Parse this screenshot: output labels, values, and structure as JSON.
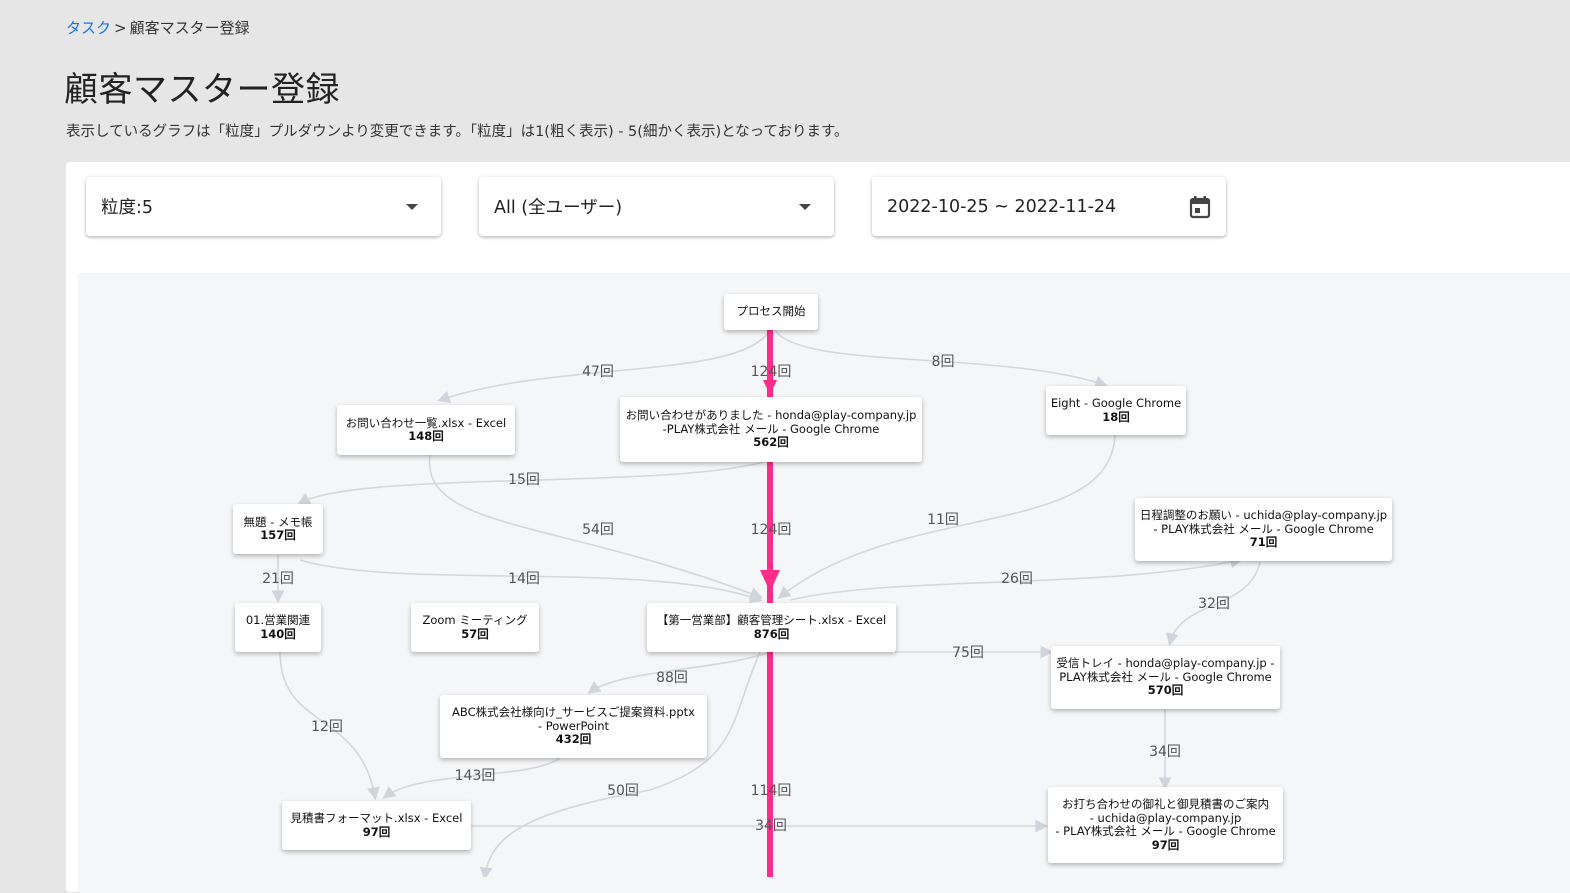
{
  "breadcrumb": {
    "link": "タスク",
    "separator": ">",
    "current": "顧客マスター登録"
  },
  "page_title": "顧客マスター登録",
  "description": "表示しているグラフは「粒度」プルダウンより変更できます。「粒度」は1(粗く表示) - 5(細かく表示)となっております。",
  "filters": {
    "granularity": "粒度:5",
    "user": "All (全ユーザー)",
    "date_range": "2022-10-25 ~ 2022-11-24"
  },
  "icons": {
    "dropdown": "caret-down-icon",
    "calendar": "calendar-icon"
  },
  "colors": {
    "main_path": "#ff2d8a",
    "edge": "#d3d8dc",
    "background": "#e6e6e6"
  },
  "nodes": {
    "start": {
      "l1": "プロセス開始"
    },
    "inquiry_list": {
      "l1": "お問い合わせ一覧.xlsx - Excel",
      "count": "148回"
    },
    "inquiry_mail": {
      "l1": "お問い合わせがありました - honda@play-company.jp",
      "l2": "-PLAY株式会社 メール - Google Chrome",
      "count": "562回"
    },
    "eight": {
      "l1": "Eight - Google Chrome",
      "count": "18回"
    },
    "memo": {
      "l1": "無題 - メモ帳",
      "count": "157回"
    },
    "schedule": {
      "l1": "日程調整のお願い - uchida@play-company.jp",
      "l2": "- PLAY株式会社 メール - Google Chrome",
      "count": "71回"
    },
    "sales": {
      "l1": "01.営業関連",
      "count": "140回"
    },
    "zoom": {
      "l1": "Zoom ミーティング",
      "count": "57回"
    },
    "customer_sheet": {
      "l1": "【第一営業部】顧客管理シート.xlsx - Excel",
      "count": "876回"
    },
    "inbox": {
      "l1": "受信トレイ - honda@play-company.jp -",
      "l2": "PLAY株式会社 メール - Google Chrome",
      "count": "570回"
    },
    "proposal": {
      "l1": "ABC株式会社様向け_サービスご提案資料.pptx",
      "l2": "- PowerPoint",
      "count": "432回"
    },
    "estimate": {
      "l1": "見積書フォーマット.xlsx - Excel",
      "count": "97回"
    },
    "thanks": {
      "l1": "お打ち合わせの御礼と御見積書のご案内",
      "l2": "- uchida@play-company.jp",
      "l3": "- PLAY株式会社 メール - Google Chrome",
      "count": "97回"
    }
  },
  "edge_labels": {
    "e47": "47回",
    "e124a": "124回",
    "e8": "8回",
    "e15": "15回",
    "e54": "54回",
    "e124b": "124回",
    "e11": "11回",
    "e21": "21回",
    "e14": "14回",
    "e26": "26回",
    "e32": "32回",
    "e75": "75回",
    "e88": "88回",
    "e12": "12回",
    "e34a": "34回",
    "e143": "143回",
    "e50": "50回",
    "e114": "114回",
    "e34b": "34回"
  }
}
